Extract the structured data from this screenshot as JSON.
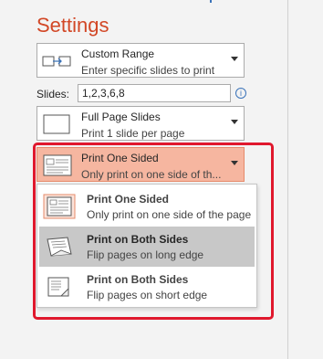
{
  "settings": {
    "title": "Settings"
  },
  "range": {
    "title": "Custom Range",
    "subtitle": "Enter specific slides to print",
    "icon": "custom-range-icon"
  },
  "slides": {
    "label": "Slides:",
    "value": "1,2,3,6,8",
    "info_icon": "info-icon"
  },
  "layout": {
    "title": "Full Page Slides",
    "subtitle": "Print 1 slide per page",
    "icon": "full-page-slide-icon"
  },
  "sides": {
    "title": "Print One Sided",
    "subtitle": "Only print on one side of th...",
    "icon": "one-sided-page-icon"
  },
  "menu": {
    "items": [
      {
        "title": "Print One Sided",
        "subtitle": "Only print on one side of the page",
        "icon": "one-sided-page-icon",
        "selected": true
      },
      {
        "title": "Print on Both Sides",
        "subtitle": "Flip pages on long edge",
        "icon": "flip-long-edge-icon",
        "hovered": true
      },
      {
        "title": "Print on Both Sides",
        "subtitle": "Flip pages on short edge",
        "icon": "flip-short-edge-icon"
      }
    ]
  },
  "colors": {
    "accent": "#d24726",
    "highlight": "#f6b6a0",
    "annotation_box": "#e0182d",
    "hover": "#c8c8c8"
  }
}
